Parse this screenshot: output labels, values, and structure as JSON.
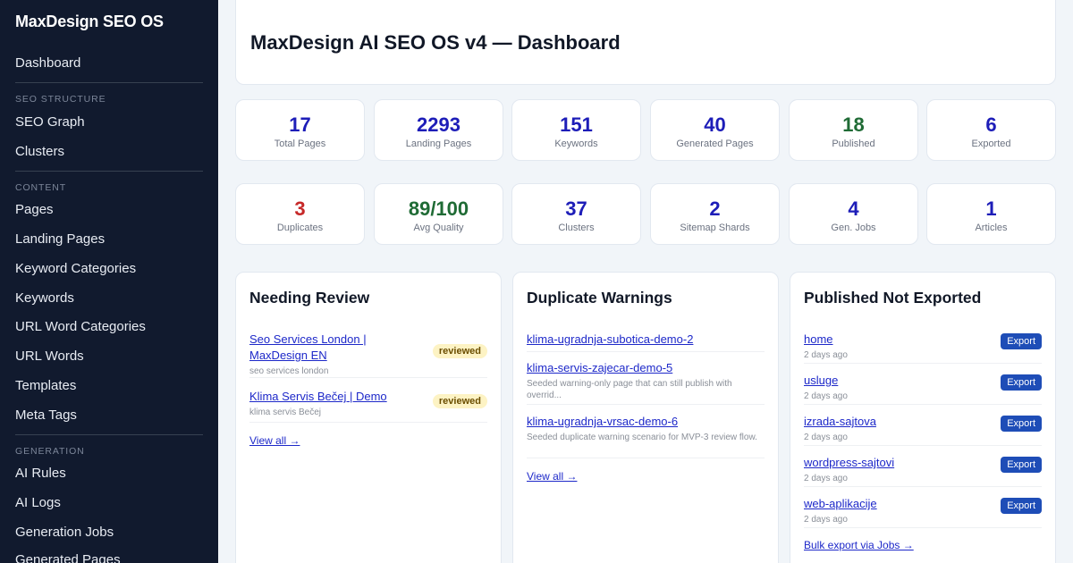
{
  "sidebar": {
    "brand": "MaxDesign SEO OS",
    "dashboard": "Dashboard",
    "sections": [
      {
        "title": "SEO STRUCTURE",
        "items": [
          "SEO Graph",
          "Clusters"
        ]
      },
      {
        "title": "CONTENT",
        "items": [
          "Pages",
          "Landing Pages",
          "Keyword Categories",
          "Keywords",
          "URL Word Categories",
          "URL Words",
          "Templates",
          "Meta Tags"
        ]
      },
      {
        "title": "GENERATION",
        "items": [
          "AI Rules",
          "AI Logs",
          "Generation Jobs",
          "Generated Pages"
        ]
      }
    ]
  },
  "header": {
    "title": "MaxDesign AI SEO OS v4 — Dashboard"
  },
  "stats_row1": [
    {
      "value": "17",
      "label": "Total Pages"
    },
    {
      "value": "2293",
      "label": "Landing Pages"
    },
    {
      "value": "151",
      "label": "Keywords"
    },
    {
      "value": "40",
      "label": "Generated Pages"
    },
    {
      "value": "18",
      "label": "Published"
    },
    {
      "value": "6",
      "label": "Exported"
    }
  ],
  "stats_row2": [
    {
      "value": "3",
      "label": "Duplicates"
    },
    {
      "value": "89/100",
      "label": "Avg Quality"
    },
    {
      "value": "37",
      "label": "Clusters"
    },
    {
      "value": "2",
      "label": "Sitemap Shards"
    },
    {
      "value": "4",
      "label": "Gen. Jobs"
    },
    {
      "value": "1",
      "label": "Articles"
    }
  ],
  "colors": {
    "accent": "#1d1db8",
    "danger": "#c62828",
    "success": "#1f6b35",
    "sidebar_bg": "#111a2e"
  },
  "needing_review": {
    "title": "Needing Review",
    "items": [
      {
        "title": "Seo Services London | MaxDesign EN",
        "sub": "seo services london",
        "badge": "reviewed"
      },
      {
        "title": "Klima Servis Bečej | Demo",
        "sub": "klima servis Bečej",
        "badge": "reviewed"
      }
    ],
    "view_all": "View all →"
  },
  "duplicate_warnings": {
    "title": "Duplicate Warnings",
    "items": [
      {
        "title": "klima-ugradnja-subotica-demo-2",
        "sub": ""
      },
      {
        "title": "klima-servis-zajecar-demo-5",
        "sub": "Seeded warning-only page that can still publish with overrid..."
      },
      {
        "title": "klima-ugradnja-vrsac-demo-6",
        "sub": "Seeded duplicate warning scenario for MVP-3 review flow."
      }
    ],
    "view_all": "View all →"
  },
  "published_not_exported": {
    "title": "Published Not Exported",
    "button_label": "Export",
    "items": [
      {
        "title": "home",
        "sub": "2 days ago"
      },
      {
        "title": "usluge",
        "sub": "2 days ago"
      },
      {
        "title": "izrada-sajtova",
        "sub": "2 days ago"
      },
      {
        "title": "wordpress-sajtovi",
        "sub": "2 days ago"
      },
      {
        "title": "web-aplikacije",
        "sub": "2 days ago"
      }
    ],
    "bulk_export": "Bulk export via Jobs →"
  }
}
